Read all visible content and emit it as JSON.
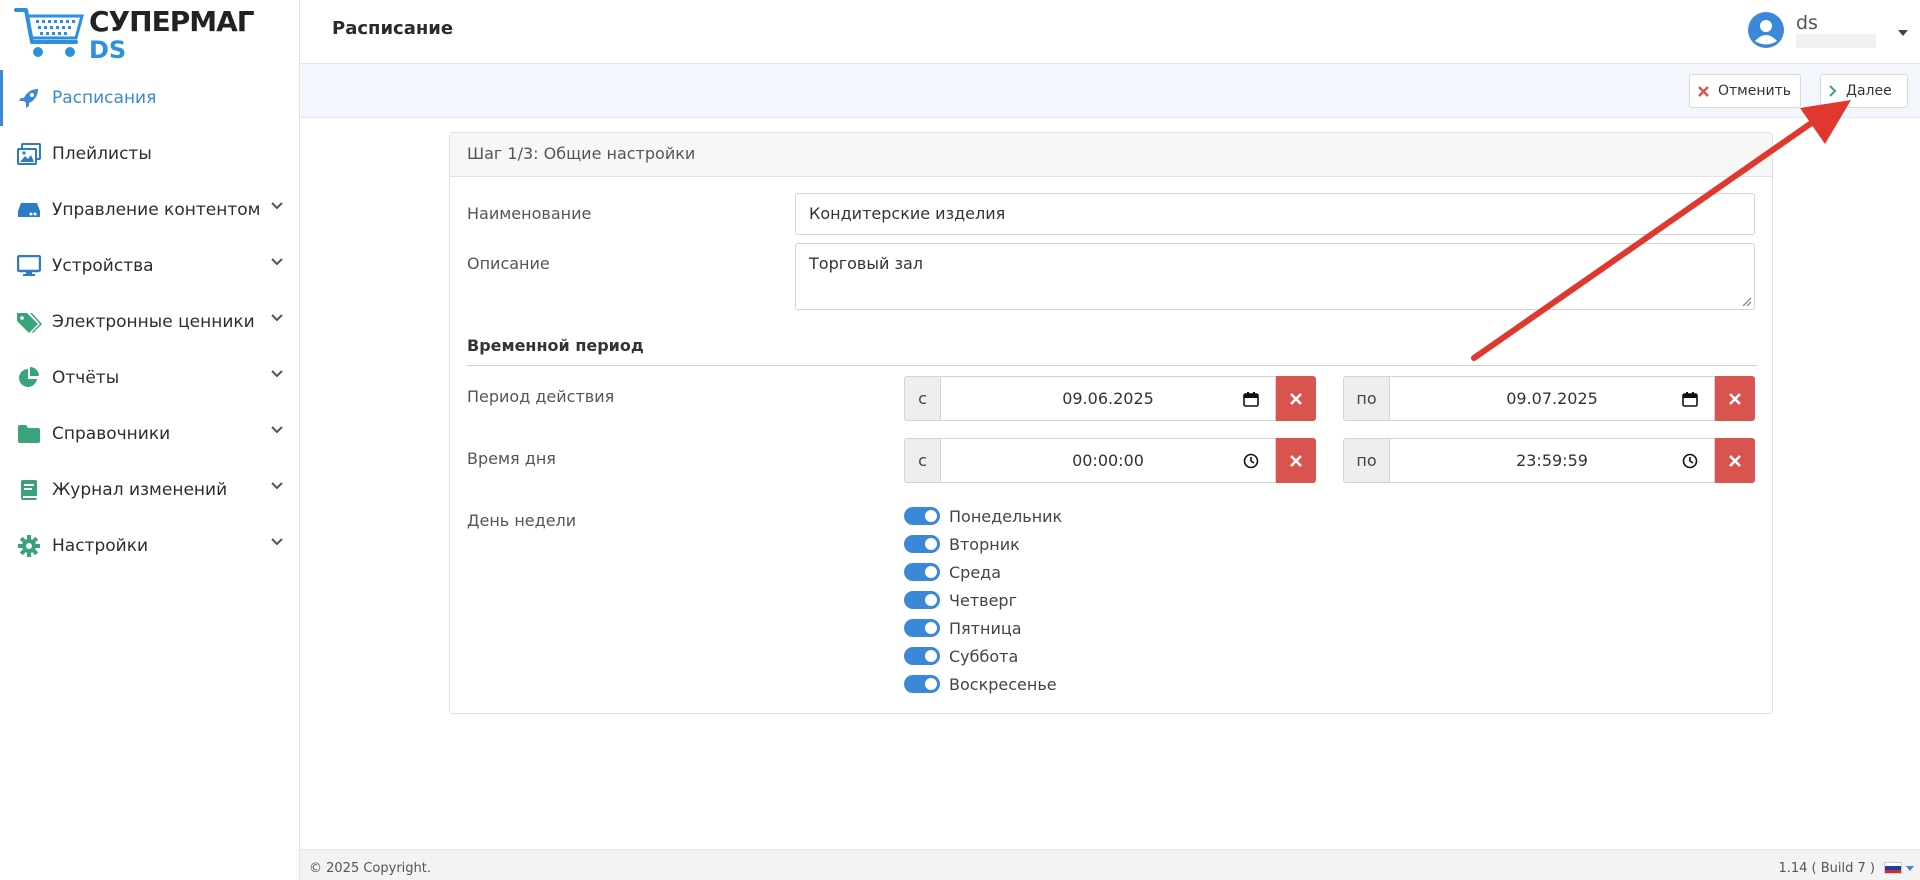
{
  "app": {
    "logo_line1": "СУПЕРМАГ",
    "logo_line2": "DS",
    "accent_color": "#3b87d8"
  },
  "sidebar": {
    "items": [
      {
        "label": "Расписания",
        "icon": "rocket-icon",
        "active": true
      },
      {
        "label": "Плейлисты",
        "icon": "images-icon"
      },
      {
        "label": "Управление контентом",
        "icon": "hdd-icon"
      },
      {
        "label": "Устройства",
        "icon": "monitor-icon"
      },
      {
        "label": "Электронные ценники",
        "icon": "tags-icon"
      },
      {
        "label": "Отчёты",
        "icon": "pie-chart-icon"
      },
      {
        "label": "Справочники",
        "icon": "folder-icon"
      },
      {
        "label": "Журнал изменений",
        "icon": "book-icon"
      },
      {
        "label": "Настройки",
        "icon": "gear-icon"
      }
    ]
  },
  "header": {
    "title": "Расписание",
    "user_name": "ds"
  },
  "toolbar": {
    "cancel_label": "Отменить",
    "next_label": "Далее"
  },
  "panel": {
    "title": "Шаг 1/3: Общие настройки",
    "name_label": "Наименование",
    "name_value": "Кондитерские изделия",
    "desc_label": "Описание",
    "desc_value": "Торговый зал",
    "section_title": "Временной период",
    "period_label": "Период действия",
    "time_label": "Время дня",
    "weekday_label": "День недели",
    "from_prefix": "с",
    "to_prefix": "по",
    "period_from": "09.06.2025",
    "period_to": "09.07.2025",
    "time_from": "00:00:00",
    "time_to": "23:59:59",
    "weekdays": [
      {
        "label": "Понедельник",
        "on": true
      },
      {
        "label": "Вторник",
        "on": true
      },
      {
        "label": "Среда",
        "on": true
      },
      {
        "label": "Четверг",
        "on": true
      },
      {
        "label": "Пятница",
        "on": true
      },
      {
        "label": "Суббота",
        "on": true
      },
      {
        "label": "Воскресенье",
        "on": true
      }
    ]
  },
  "footer": {
    "copyright": "© 2025 Copyright.",
    "version": "1.14 ( Build 7 )"
  }
}
